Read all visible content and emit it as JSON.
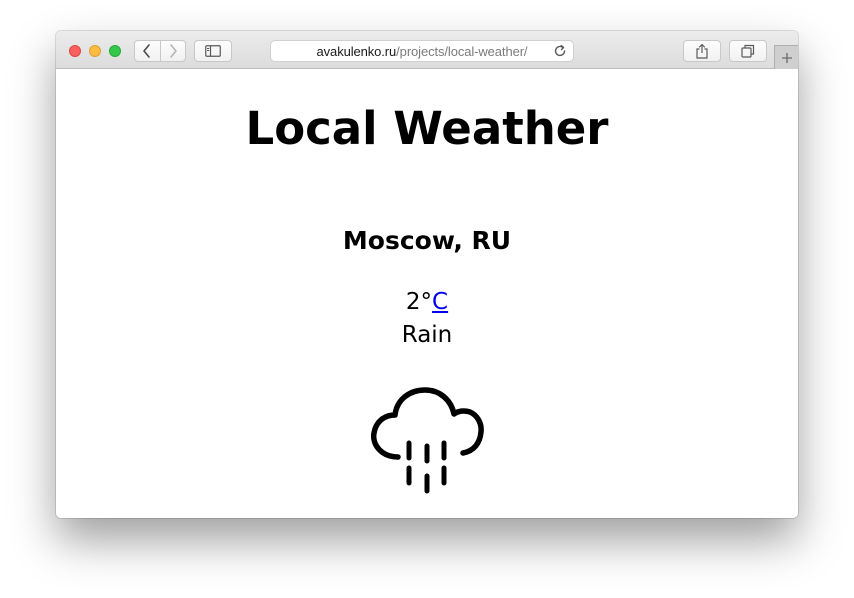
{
  "browser": {
    "url_host": "avakulenko.ru",
    "url_path": "/projects/local-weather/",
    "icons": {
      "back": "chevron-left-icon",
      "forward": "chevron-right-icon",
      "sidebar": "sidebar-icon",
      "reload": "reload-icon",
      "share": "share-icon",
      "tabs": "tabs-overview-icon",
      "new_tab": "plus-icon"
    }
  },
  "page": {
    "title": "Local Weather",
    "location": "Moscow, RU",
    "temperature": "2°",
    "unit": "C",
    "condition": "Rain",
    "icon": "rain-cloud-icon",
    "colors": {
      "link": "#0000ee",
      "text": "#000000"
    }
  }
}
